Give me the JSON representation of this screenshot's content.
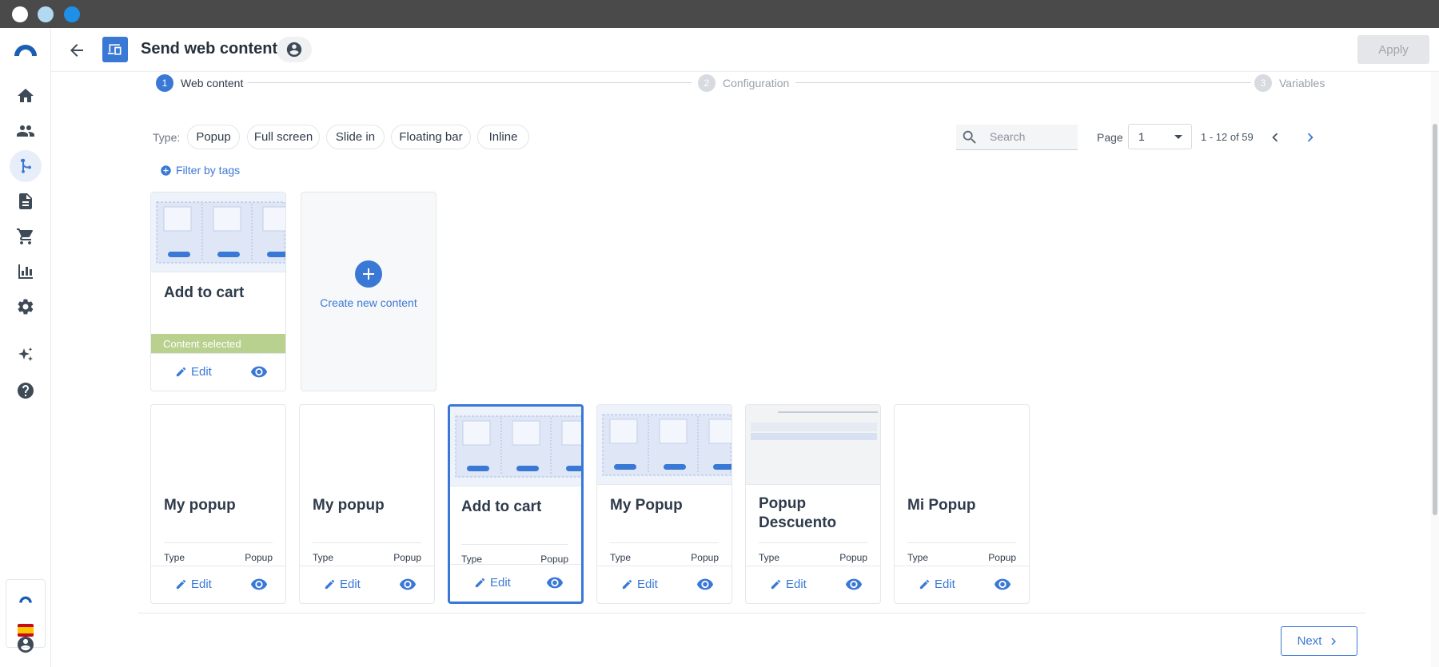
{
  "window": {
    "dot_colors": [
      "#ffffff",
      "#b3d9f2",
      "#1e90e6"
    ]
  },
  "header": {
    "title": "Send web content",
    "apply_label": "Apply"
  },
  "steps": [
    {
      "num": "1",
      "label": "Web content",
      "active": true
    },
    {
      "num": "2",
      "label": "Configuration",
      "active": false
    },
    {
      "num": "3",
      "label": "Variables",
      "active": false
    }
  ],
  "filters": {
    "type_label": "Type:",
    "types": [
      "Popup",
      "Full screen",
      "Slide in",
      "Floating bar",
      "Inline"
    ],
    "filter_by_tags": "Filter by tags",
    "search_placeholder": "Search",
    "page_label": "Page",
    "page_value": "1",
    "range": "1 - 12 of 59"
  },
  "selected_card": {
    "name": "Add to cart",
    "status": "Content selected",
    "edit_label": "Edit"
  },
  "create_card": {
    "label": "Create new content"
  },
  "cards": [
    {
      "name": "My popup",
      "type_label": "Type",
      "type_value": "Popup",
      "edit_label": "Edit",
      "thumb": "none"
    },
    {
      "name": "My popup",
      "type_label": "Type",
      "type_value": "Popup",
      "edit_label": "Edit",
      "thumb": "none"
    },
    {
      "name": "Add to cart",
      "type_label": "Type",
      "type_value": "Popup",
      "edit_label": "Edit",
      "thumb": "products"
    },
    {
      "name": "My Popup",
      "type_label": "Type",
      "type_value": "Popup",
      "edit_label": "Edit",
      "thumb": "products"
    },
    {
      "name": "Popup Descuento",
      "type_label": "Type",
      "type_value": "Popup",
      "edit_label": "Edit",
      "thumb": "discount"
    },
    {
      "name": "Mi Popup",
      "type_label": "Type",
      "type_value": "Popup",
      "edit_label": "Edit",
      "thumb": "none"
    }
  ],
  "footer": {
    "next_label": "Next"
  },
  "colors": {
    "accent": "#3a78d6",
    "selected": "#b9d18e",
    "brand": "#1a5fb4"
  }
}
